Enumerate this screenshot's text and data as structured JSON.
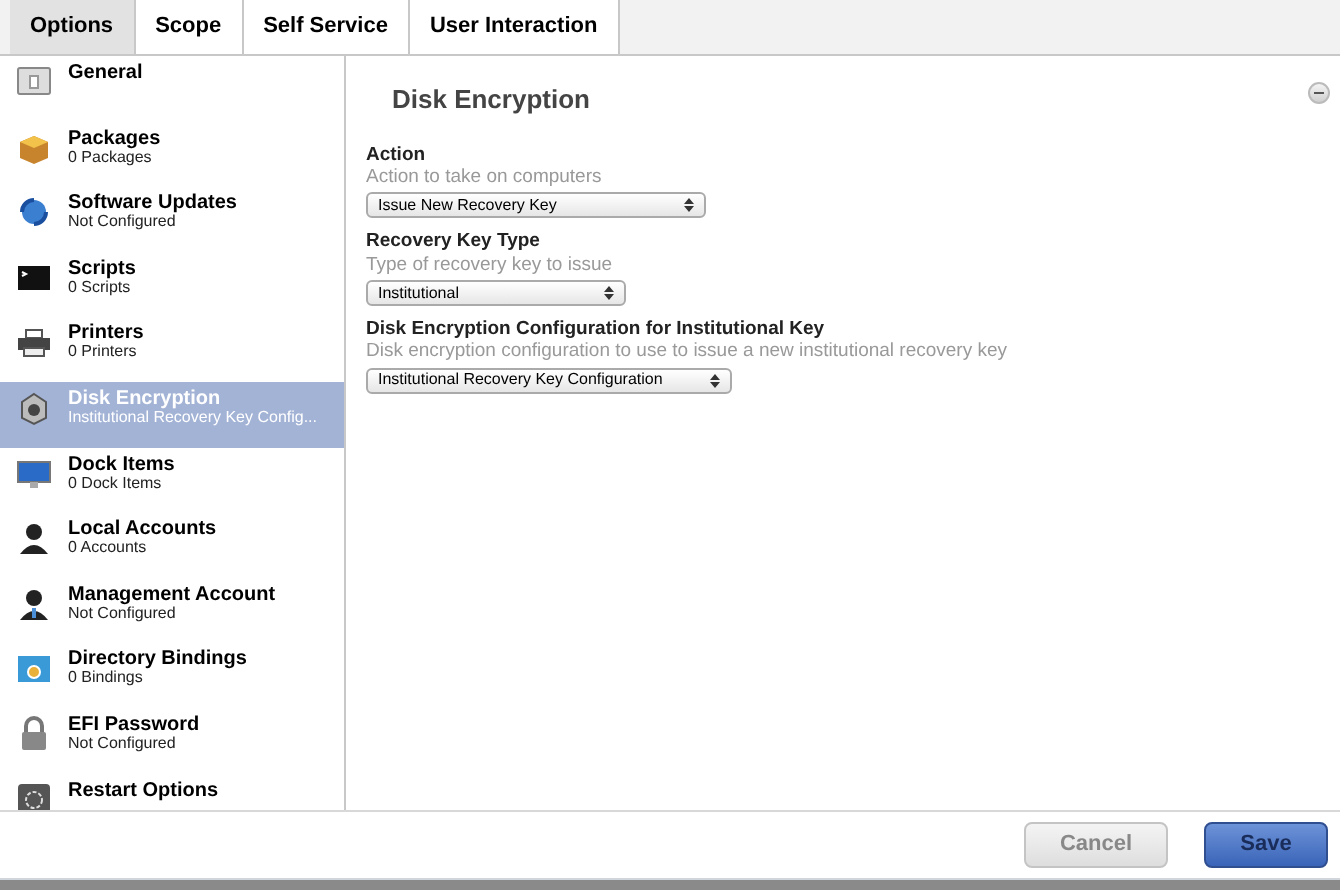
{
  "tabs": [
    {
      "label": "Options",
      "selected": true
    },
    {
      "label": "Scope",
      "selected": false
    },
    {
      "label": "Self Service",
      "selected": false
    },
    {
      "label": "User Interaction",
      "selected": false
    }
  ],
  "sidebar": {
    "items": [
      {
        "title": "General",
        "selected": false
      },
      {
        "title": "Packages",
        "subtitle": "0 Packages",
        "selected": false
      },
      {
        "title": "Software Updates",
        "subtitle": "Not Configured",
        "selected": false
      },
      {
        "title": "Scripts",
        "subtitle": "0 Scripts",
        "selected": false
      },
      {
        "title": "Printers",
        "subtitle": "0 Printers",
        "selected": false
      },
      {
        "title": "Disk Encryption",
        "subtitle": "Institutional Recovery Key Config...",
        "selected": true
      },
      {
        "title": "Dock Items",
        "subtitle": "0 Dock Items",
        "selected": false
      },
      {
        "title": "Local Accounts",
        "subtitle": "0 Accounts",
        "selected": false
      },
      {
        "title": "Management Account",
        "subtitle": "Not Configured",
        "selected": false
      },
      {
        "title": "Directory Bindings",
        "subtitle": "0 Bindings",
        "selected": false
      },
      {
        "title": "EFI Password",
        "subtitle": "Not Configured",
        "selected": false
      },
      {
        "title": "Restart Options",
        "selected": false
      }
    ]
  },
  "panel": {
    "title": "Disk Encryption",
    "fields": [
      {
        "label": "Action",
        "description": "Action to take on computers",
        "value": "Issue New Recovery Key"
      },
      {
        "label": "Recovery Key Type",
        "description": "Type of recovery key to issue",
        "value": "Institutional"
      },
      {
        "label": "Disk Encryption Configuration for Institutional Key",
        "description": "Disk encryption configuration to use to issue a new institutional recovery key",
        "value": "Institutional Recovery Key Configuration"
      }
    ]
  },
  "buttons": [
    {
      "label": "Cancel",
      "kind": "secondary"
    },
    {
      "label": "Save",
      "kind": "primary"
    }
  ]
}
